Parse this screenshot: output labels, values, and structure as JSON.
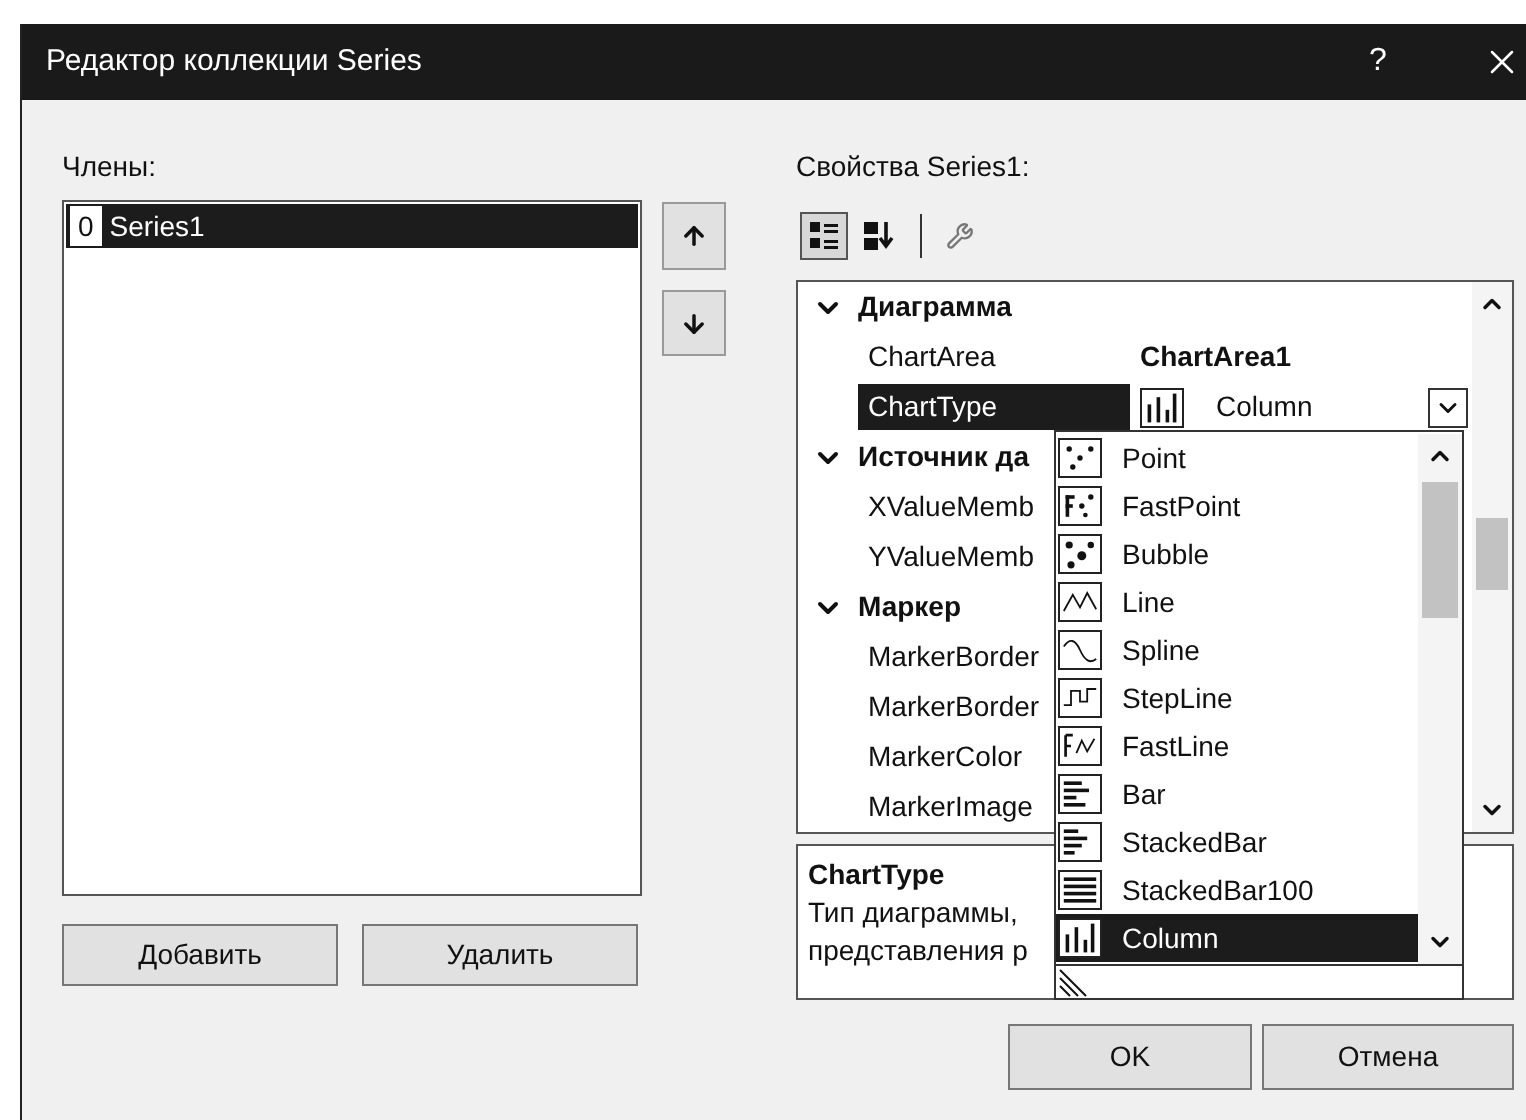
{
  "window": {
    "title": "Редактор коллекции Series",
    "help": "?"
  },
  "members": {
    "label": "Члены:",
    "items": [
      {
        "index": "0",
        "name": "Series1",
        "selected": true
      }
    ]
  },
  "member_buttons": [
    "Добавить",
    "Удалить"
  ],
  "properties": {
    "label": "Свойства Series1:",
    "view_buttons": [
      {
        "kind": "categorized",
        "selected": true
      },
      {
        "kind": "alphabetical",
        "selected": false
      }
    ],
    "rows": [
      {
        "kind": "category",
        "name": "Диаграмма",
        "expanded": true
      },
      {
        "kind": "property",
        "name": "ChartArea",
        "value": "ChartArea1",
        "bold": true,
        "selected": false
      },
      {
        "kind": "property",
        "name": "ChartType",
        "value": "Column",
        "bold": false,
        "selected": true
      },
      {
        "kind": "category",
        "name": "Источник да",
        "expanded": true
      },
      {
        "kind": "property",
        "name": "XValueMemb",
        "selected": false
      },
      {
        "kind": "property",
        "name": "YValueMemb",
        "selected": false
      },
      {
        "kind": "category",
        "name": "Маркер",
        "expanded": true
      },
      {
        "kind": "property",
        "name": "MarkerBorder",
        "selected": false
      },
      {
        "kind": "property",
        "name": "MarkerBorder",
        "selected": false
      },
      {
        "kind": "property",
        "name": "MarkerColor",
        "selected": false
      },
      {
        "kind": "property",
        "name": "MarkerImage",
        "selected": false
      }
    ],
    "description": {
      "title": "ChartType",
      "lines": [
        "Тип диаграммы,",
        "представления р"
      ]
    }
  },
  "dropdown": {
    "items": [
      {
        "label": "Point",
        "selected": false
      },
      {
        "label": "FastPoint",
        "selected": false
      },
      {
        "label": "Bubble",
        "selected": false
      },
      {
        "label": "Line",
        "selected": false
      },
      {
        "label": "Spline",
        "selected": false
      },
      {
        "label": "StepLine",
        "selected": false
      },
      {
        "label": "FastLine",
        "selected": false
      },
      {
        "label": "Bar",
        "selected": false
      },
      {
        "label": "StackedBar",
        "selected": false
      },
      {
        "label": "StackedBar100",
        "selected": false
      },
      {
        "label": "Column",
        "selected": true
      }
    ]
  },
  "dialog_buttons": [
    "OK",
    "Отмена"
  ]
}
